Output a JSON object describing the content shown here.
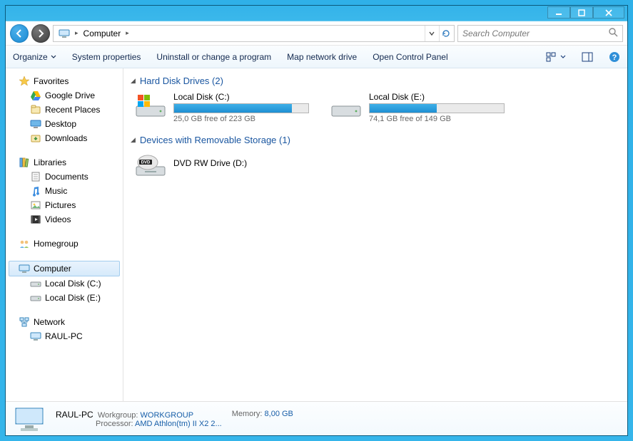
{
  "titlebar": {
    "buttons": [
      "minimize",
      "maximize",
      "close"
    ]
  },
  "nav": {
    "location_root": "Computer",
    "search_placeholder": "Search Computer"
  },
  "cmdbar": {
    "organize": "Organize",
    "system_properties": "System properties",
    "uninstall": "Uninstall or change a program",
    "map_drive": "Map network drive",
    "control_panel": "Open Control Panel"
  },
  "sidebar": {
    "favorites": {
      "label": "Favorites",
      "items": [
        {
          "icon": "gdrive",
          "label": "Google Drive"
        },
        {
          "icon": "recent",
          "label": "Recent Places"
        },
        {
          "icon": "desktop",
          "label": "Desktop"
        },
        {
          "icon": "downloads",
          "label": "Downloads"
        }
      ]
    },
    "libraries": {
      "label": "Libraries",
      "items": [
        {
          "icon": "doc",
          "label": "Documents"
        },
        {
          "icon": "music",
          "label": "Music"
        },
        {
          "icon": "pic",
          "label": "Pictures"
        },
        {
          "icon": "vid",
          "label": "Videos"
        }
      ]
    },
    "homegroup": {
      "label": "Homegroup"
    },
    "computer": {
      "label": "Computer",
      "items": [
        {
          "icon": "disk",
          "label": "Local Disk (C:)"
        },
        {
          "icon": "disk",
          "label": "Local Disk (E:)"
        }
      ]
    },
    "network": {
      "label": "Network",
      "items": [
        {
          "icon": "pc",
          "label": "RAUL-PC"
        }
      ]
    }
  },
  "content": {
    "hdd_header": "Hard Disk Drives (2)",
    "drives": [
      {
        "label": "Local Disk (C:)",
        "free": "25,0 GB free of 223 GB",
        "free_gb": 25.0,
        "total_gb": 223,
        "icon": "os"
      },
      {
        "label": "Local Disk (E:)",
        "free": "74,1 GB free of 149 GB",
        "free_gb": 74.1,
        "total_gb": 149,
        "icon": "hdd"
      }
    ],
    "removable_header": "Devices with Removable Storage (1)",
    "removable": [
      {
        "label": "DVD RW Drive (D:)",
        "icon": "dvd"
      }
    ]
  },
  "details": {
    "name": "RAUL-PC",
    "workgroup_k": "Workgroup:",
    "workgroup_v": "WORKGROUP",
    "processor_k": "Processor:",
    "processor_v": "AMD Athlon(tm) II X2 2...",
    "memory_k": "Memory:",
    "memory_v": "8,00 GB"
  }
}
